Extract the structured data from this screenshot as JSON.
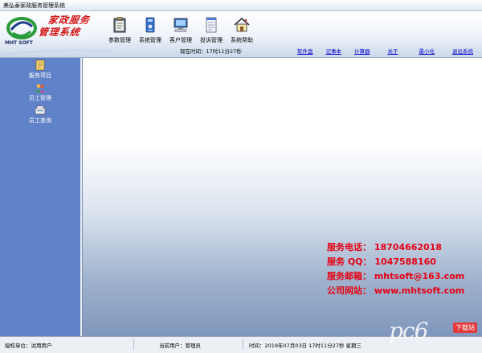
{
  "window": {
    "title": "美弘泰家政服务管理系统"
  },
  "logo": {
    "sub_text": "MHT SOFT"
  },
  "brand": {
    "line1": "家政服务",
    "line2": "管理系统"
  },
  "toolbar": {
    "items": [
      {
        "label": "参数管理",
        "icon": "clipboard-icon"
      },
      {
        "label": "系统管理",
        "icon": "system-icon"
      },
      {
        "label": "客户管理",
        "icon": "computer-icon"
      },
      {
        "label": "投诉管理",
        "icon": "document-icon"
      },
      {
        "label": "系统帮助",
        "icon": "home-icon"
      }
    ]
  },
  "timebar": {
    "now": "现在时间：17时11分27秒",
    "links": [
      "软件盘",
      "记事本",
      "计算器",
      "关于",
      "最小化",
      "退出系统"
    ]
  },
  "sidebar": {
    "items": [
      {
        "label": "服务项目",
        "icon": "service-icon"
      },
      {
        "label": "员工管理",
        "icon": "staff-icon"
      },
      {
        "label": "员工查询",
        "icon": "query-icon"
      }
    ]
  },
  "contact": {
    "phone": "服务电话： 18704662018",
    "qq": "服务 QQ： 1047588160",
    "email": "服务邮箱： mhtsoft@163.com",
    "site": "公司网站： www.mhtsoft.com"
  },
  "status": {
    "unit": "授权单位：试用用户",
    "user": "当前用户：管理员",
    "datetime": "时间：2019年07月03日 17时11分27秒  星期三"
  },
  "watermark": {
    "text": "pc6",
    "tag": "下载站"
  },
  "colors": {
    "sidebar": "#5f82c8",
    "contact": "#e60012",
    "link": "#0000cc"
  }
}
